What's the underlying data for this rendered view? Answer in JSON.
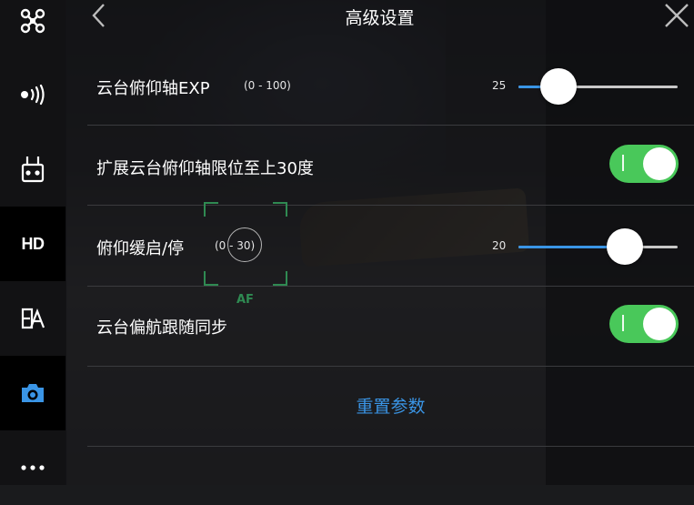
{
  "header": {
    "title": "高级设置"
  },
  "sidebar": {
    "items": [
      {
        "icon": "drone-icon"
      },
      {
        "icon": "signal-transmission-icon"
      },
      {
        "icon": "remote-controller-icon"
      },
      {
        "label": "HD",
        "icon": "hd-video-icon"
      },
      {
        "icon": "language-icon"
      },
      {
        "icon": "camera-icon",
        "active": true,
        "color": "#3a95e6"
      },
      {
        "icon": "more-icon"
      }
    ]
  },
  "settings": {
    "pitch_exp": {
      "label": "云台俯仰轴EXP",
      "range": "(0 - 100)",
      "value": "25",
      "fraction": 0.25
    },
    "extend_pitch_limit": {
      "label": "扩展云台俯仰轴限位至上30度",
      "on": true
    },
    "pitch_smooth": {
      "label": "俯仰缓启/停",
      "range": "(0 - 30)",
      "value": "20",
      "fraction": 0.6667
    },
    "yaw_follow_sync": {
      "label": "云台偏航跟随同步",
      "on": true
    },
    "reset_label": "重置参数"
  },
  "camera_overlay": {
    "af_label": "AF"
  },
  "colors": {
    "accent": "#3a95e6",
    "toggle_on": "#49c85a",
    "af_frame": "#2f8a52"
  }
}
